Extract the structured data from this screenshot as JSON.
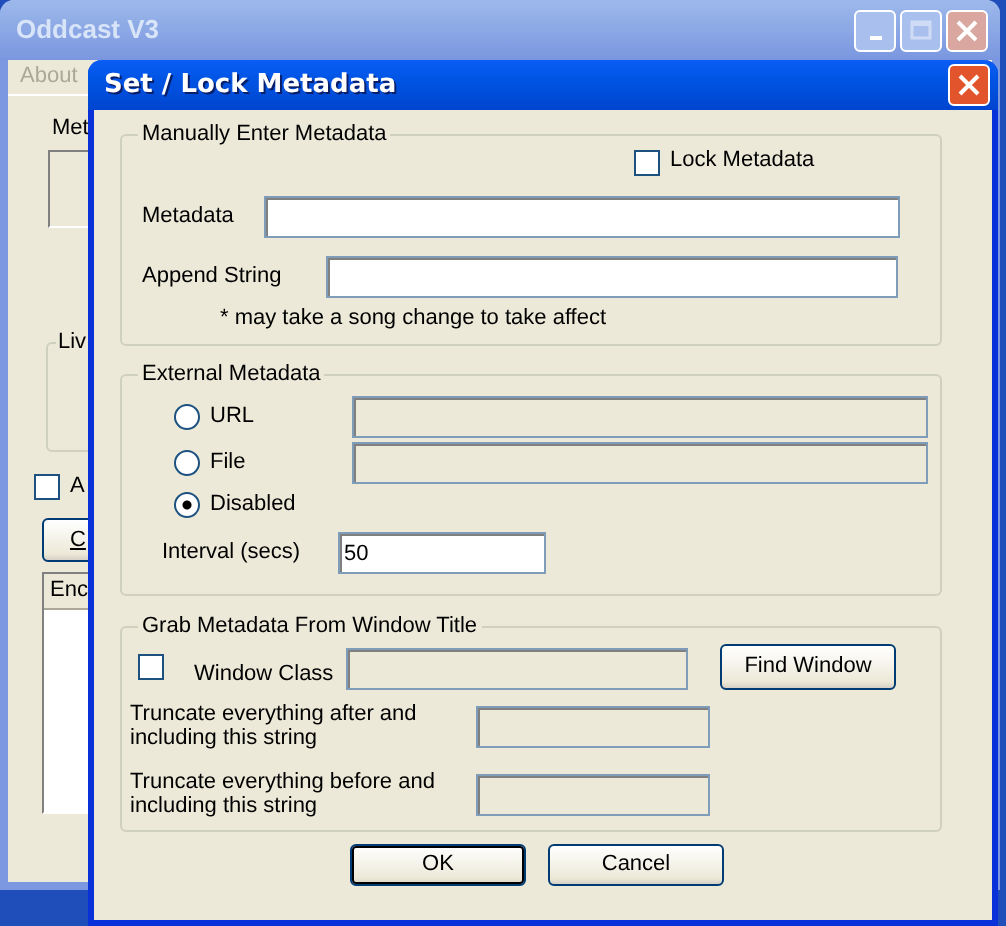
{
  "main_window": {
    "title": "Oddcast V3",
    "menu": [
      {
        "label": "About",
        "disabled": true
      }
    ],
    "metadata_label": "Met",
    "live_group_label": "Liv",
    "checkbox": {
      "label": "A",
      "checked": false
    },
    "button": "C",
    "list_column": "Enc"
  },
  "dialog": {
    "title": "Set / Lock Metadata",
    "manual": {
      "legend": "Manually Enter Metadata",
      "lock": {
        "label": "Lock Metadata",
        "checked": false
      },
      "metadata_label": "Metadata",
      "append_label": "Append String",
      "note": "* may take a song change to take affect"
    },
    "external": {
      "legend": "External Metadata",
      "options": [
        {
          "label": "URL",
          "selected": false,
          "kind": "field"
        },
        {
          "label": "File",
          "selected": false,
          "kind": "field"
        },
        {
          "label": "Disabled",
          "selected": true,
          "kind": "plain"
        }
      ],
      "fields_disabled": true,
      "interval": {
        "label": "Interval (secs)",
        "value": "50"
      }
    },
    "window_title": {
      "legend": "Grab Metadata From Window Title",
      "window_class": {
        "label": "Window Class",
        "checked": false,
        "disabled": true
      },
      "find_button": "Find Window",
      "truncate": [
        {
          "label": "Truncate everything after and including this string",
          "disabled": true
        },
        {
          "label": "Truncate everything before and including this string",
          "disabled": true
        }
      ]
    },
    "buttons": [
      {
        "label": "OK",
        "default": true
      },
      {
        "label": "Cancel",
        "default": false
      }
    ]
  }
}
